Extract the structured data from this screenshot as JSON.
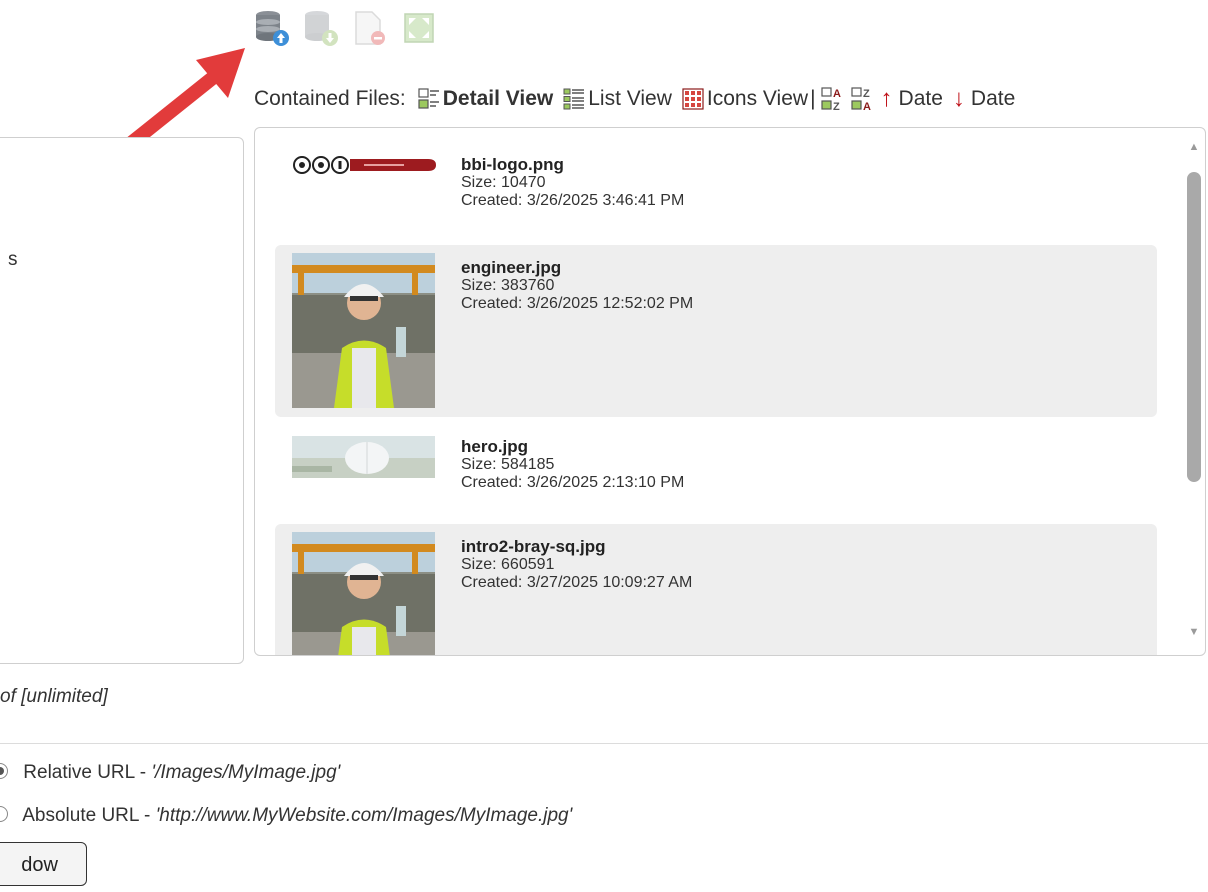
{
  "toolbar": {
    "icons": [
      "database-upload-icon",
      "database-download-icon",
      "delete-file-icon",
      "resize-image-icon"
    ]
  },
  "view_bar": {
    "label": "Contained Files:",
    "detail_view": "Detail View",
    "list_view": "List View",
    "icons_view": "Icons View",
    "separator": "|",
    "sort_date_asc": "Date",
    "sort_date_desc": "Date"
  },
  "left_panel": {
    "partial_text": "s"
  },
  "files": [
    {
      "name": "bbi-logo.png",
      "size": "Size: 10470",
      "created": "Created: 3/26/2025 3:46:41 PM"
    },
    {
      "name": "engineer.jpg",
      "size": "Size: 383760",
      "created": "Created: 3/26/2025 12:52:02 PM"
    },
    {
      "name": "hero.jpg",
      "size": "Size: 584185",
      "created": "Created: 3/26/2025 2:13:10 PM"
    },
    {
      "name": "intro2-bray-sq.jpg",
      "size": "Size: 660591",
      "created": "Created: 3/27/2025 10:09:27 AM"
    }
  ],
  "limit_text": "of [unlimited]",
  "url_options": {
    "relative_label": "Relative URL - ",
    "relative_example": "'/Images/MyImage.jpg'",
    "absolute_label": "Absolute URL - ",
    "absolute_example": "'http://www.MyWebsite.com/Images/MyImage.jpg'"
  },
  "window_button": "dow",
  "colors": {
    "accent_red": "#c0141b",
    "arrow_red": "#e23b3b",
    "alt_row": "#eeeeee"
  }
}
